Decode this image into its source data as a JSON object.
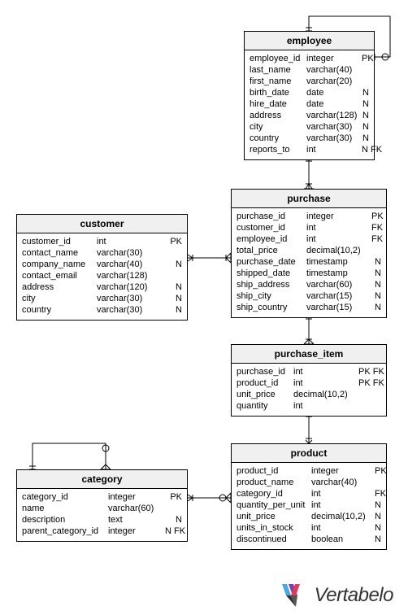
{
  "logo": {
    "text": "Vertabelo"
  },
  "entities": {
    "employee": {
      "title": "employee",
      "cols": [
        {
          "name": "employee_id",
          "type": "integer",
          "flags": "PK"
        },
        {
          "name": "last_name",
          "type": "varchar(40)",
          "flags": ""
        },
        {
          "name": "first_name",
          "type": "varchar(20)",
          "flags": ""
        },
        {
          "name": "birth_date",
          "type": "date",
          "flags": "N"
        },
        {
          "name": "hire_date",
          "type": "date",
          "flags": "N"
        },
        {
          "name": "address",
          "type": "varchar(128)",
          "flags": "N"
        },
        {
          "name": "city",
          "type": "varchar(30)",
          "flags": "N"
        },
        {
          "name": "country",
          "type": "varchar(30)",
          "flags": "N"
        },
        {
          "name": "reports_to",
          "type": "int",
          "flags": "N FK"
        }
      ]
    },
    "customer": {
      "title": "customer",
      "cols": [
        {
          "name": "customer_id",
          "type": "int",
          "flags": "PK"
        },
        {
          "name": "contact_name",
          "type": "varchar(30)",
          "flags": ""
        },
        {
          "name": "company_name",
          "type": "varchar(40)",
          "flags": "N"
        },
        {
          "name": "contact_email",
          "type": "varchar(128)",
          "flags": ""
        },
        {
          "name": "address",
          "type": "varchar(120)",
          "flags": "N"
        },
        {
          "name": "city",
          "type": "varchar(30)",
          "flags": "N"
        },
        {
          "name": "country",
          "type": "varchar(30)",
          "flags": "N"
        }
      ]
    },
    "purchase": {
      "title": "purchase",
      "cols": [
        {
          "name": "purchase_id",
          "type": "integer",
          "flags": "PK"
        },
        {
          "name": "customer_id",
          "type": "int",
          "flags": "FK"
        },
        {
          "name": "employee_id",
          "type": "int",
          "flags": "FK"
        },
        {
          "name": "total_price",
          "type": "decimal(10,2)",
          "flags": ""
        },
        {
          "name": "purchase_date",
          "type": "timestamp",
          "flags": "N"
        },
        {
          "name": "shipped_date",
          "type": "timestamp",
          "flags": "N"
        },
        {
          "name": "ship_address",
          "type": "varchar(60)",
          "flags": "N"
        },
        {
          "name": "ship_city",
          "type": "varchar(15)",
          "flags": "N"
        },
        {
          "name": "ship_country",
          "type": "varchar(15)",
          "flags": "N"
        }
      ]
    },
    "purchase_item": {
      "title": "purchase_item",
      "cols": [
        {
          "name": "purchase_id",
          "type": "int",
          "flags": "PK FK"
        },
        {
          "name": "product_id",
          "type": "int",
          "flags": "PK FK"
        },
        {
          "name": "unit_price",
          "type": "decimal(10,2)",
          "flags": ""
        },
        {
          "name": "quantity",
          "type": "int",
          "flags": ""
        }
      ]
    },
    "category": {
      "title": "category",
      "cols": [
        {
          "name": "category_id",
          "type": "integer",
          "flags": "PK"
        },
        {
          "name": "name",
          "type": "varchar(60)",
          "flags": ""
        },
        {
          "name": "description",
          "type": "text",
          "flags": "N"
        },
        {
          "name": "parent_category_id",
          "type": "integer",
          "flags": "N FK"
        }
      ]
    },
    "product": {
      "title": "product",
      "cols": [
        {
          "name": "product_id",
          "type": "integer",
          "flags": "PK"
        },
        {
          "name": "product_name",
          "type": "varchar(40)",
          "flags": ""
        },
        {
          "name": "category_id",
          "type": "int",
          "flags": "FK"
        },
        {
          "name": "quantity_per_unit",
          "type": "int",
          "flags": "N"
        },
        {
          "name": "unit_price",
          "type": "decimal(10,2)",
          "flags": "N"
        },
        {
          "name": "units_in_stock",
          "type": "int",
          "flags": "N"
        },
        {
          "name": "discontinued",
          "type": "boolean",
          "flags": "N"
        }
      ]
    }
  }
}
